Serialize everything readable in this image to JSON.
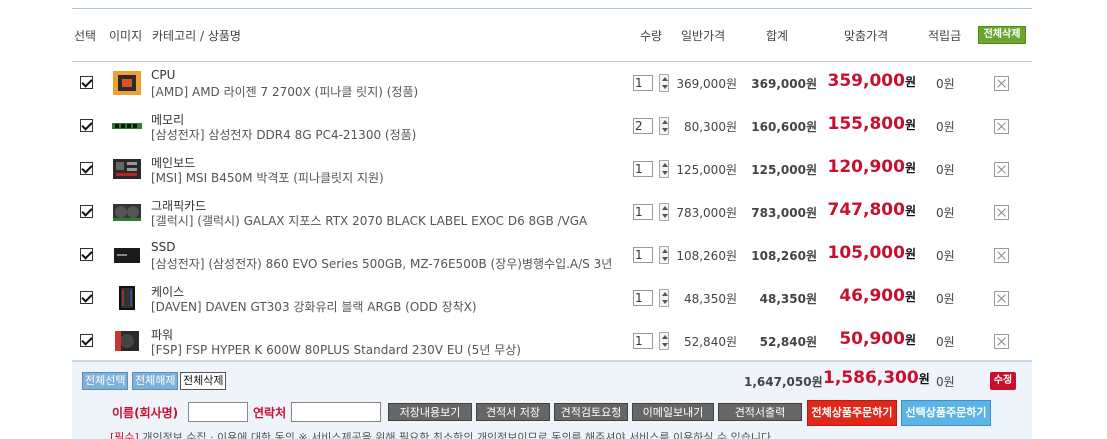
{
  "header": {
    "select": "선택",
    "image": "이미지",
    "category_name": "카테고리 / 상품명",
    "qty": "수량",
    "price": "일반가격",
    "sum": "합계",
    "fit_price": "맞춤가격",
    "point": "적립금",
    "delete_all": "전체삭제"
  },
  "items": [
    {
      "category": "CPU",
      "name": "[AMD] AMD 라이젠 7 2700X (피나클 릿지) (정품)",
      "qty": "1",
      "price": "369,000원",
      "sum": "369,000원",
      "fit": "359,000",
      "won": "원",
      "point": "0원",
      "thumb": "cpu"
    },
    {
      "category": "메모리",
      "name": "[삼성전자] 삼성전자 DDR4 8G PC4-21300 (정품)",
      "qty": "2",
      "price": "80,300원",
      "sum": "160,600원",
      "fit": "155,800",
      "won": "원",
      "point": "0원",
      "thumb": "ram"
    },
    {
      "category": "메인보드",
      "name": "[MSI] MSI B450M 박격포 (피나클릿지 지원)",
      "qty": "1",
      "price": "125,000원",
      "sum": "125,000원",
      "fit": "120,900",
      "won": "원",
      "point": "0원",
      "thumb": "board"
    },
    {
      "category": "그래픽카드",
      "name": "[갤럭시] (갤럭시) GALAX 지포스 RTX 2070 BLACK LABEL EXOC D6 8GB /VGA",
      "qty": "1",
      "price": "783,000원",
      "sum": "783,000원",
      "fit": "747,800",
      "won": "원",
      "point": "0원",
      "thumb": "gpu"
    },
    {
      "category": "SSD",
      "name": "[삼성전자] (삼성전자) 860 EVO Series 500GB, MZ-76E500B (장우)병행수입.A/S 3년",
      "qty": "1",
      "price": "108,260원",
      "sum": "108,260원",
      "fit": "105,000",
      "won": "원",
      "point": "0원",
      "thumb": "ssd"
    },
    {
      "category": "케이스",
      "name": "[DAVEN] DAVEN GT303 강화유리 블랙 ARGB (ODD 장착X)",
      "qty": "1",
      "price": "48,350원",
      "sum": "48,350원",
      "fit": "46,900",
      "won": "원",
      "point": "0원",
      "thumb": "case"
    },
    {
      "category": "파워",
      "name": "[FSP] FSP HYPER K 600W 80PLUS Standard 230V EU (5년 무상)",
      "qty": "1",
      "price": "52,840원",
      "sum": "52,840원",
      "fit": "50,900",
      "won": "원",
      "point": "0원",
      "thumb": "psu"
    }
  ],
  "footer": {
    "select_all": "전체선택",
    "unselect_all": "전체해제",
    "delete_all": "전체삭제",
    "total": "1,647,050원",
    "fit_total": "1,586,300",
    "won": "원",
    "point_total": "0원",
    "edit": "수정",
    "name_label": "이름(회사명)",
    "contact_label": "연락처",
    "btn_save_view": "저장내용보기",
    "btn_save_quote": "견적서 저장",
    "btn_review": "견적검토요청",
    "btn_email": "이메일보내기",
    "btn_print": "견적서출력",
    "btn_order_all": "전체상품주문하기",
    "btn_order_sel": "선택상품주문하기",
    "notice_tag": "[필수]",
    "notice_text": " 개인정보 수집 · 이용에 대한 동의  ※ 서비스제공을 위해 필요한 최소한의 개인정보이므로 동의를 해주셔야 서비스를 이용하실 수 있습니다."
  },
  "colors": {
    "accent_red": "#c8102e",
    "header_border": "#a9c5dc",
    "footer_bg": "#eef4fa"
  }
}
